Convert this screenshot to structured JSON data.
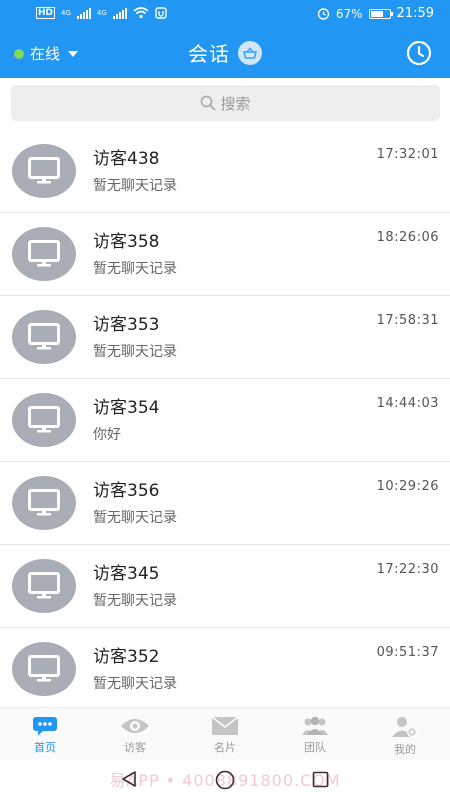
{
  "status_bar": {
    "left": [
      "HD",
      "4G",
      "4G"
    ],
    "battery_percent": "67%",
    "battery_level": 0.67,
    "time": "21:59"
  },
  "header": {
    "status_label": "在线",
    "title": "会话",
    "icons": [
      "basket-icon",
      "clock-icon"
    ],
    "accent": "#2196f3"
  },
  "search": {
    "placeholder": "搜索"
  },
  "conversations": [
    {
      "name": "访客438",
      "time": "17:32:01",
      "message": "暂无聊天记录"
    },
    {
      "name": "访客358",
      "time": "18:26:06",
      "message": "暂无聊天记录"
    },
    {
      "name": "访客353",
      "time": "17:58:31",
      "message": "暂无聊天记录"
    },
    {
      "name": "访客354",
      "time": "14:44:03",
      "message": "你好"
    },
    {
      "name": "访客356",
      "time": "10:29:26",
      "message": "暂无聊天记录"
    },
    {
      "name": "访客345",
      "time": "17:22:30",
      "message": "暂无聊天记录"
    },
    {
      "name": "访客352",
      "time": "09:51:37",
      "message": "暂无聊天记录"
    }
  ],
  "tabs": [
    {
      "label": "首页",
      "icon": "chat-bubble-icon",
      "active": true
    },
    {
      "label": "访客",
      "icon": "eye-icon",
      "active": false
    },
    {
      "label": "名片",
      "icon": "envelope-icon",
      "active": false
    },
    {
      "label": "团队",
      "icon": "team-icon",
      "active": false
    },
    {
      "label": "我的",
      "icon": "user-settings-icon",
      "active": false
    }
  ],
  "watermark": "易APP • 4008891800.COM"
}
